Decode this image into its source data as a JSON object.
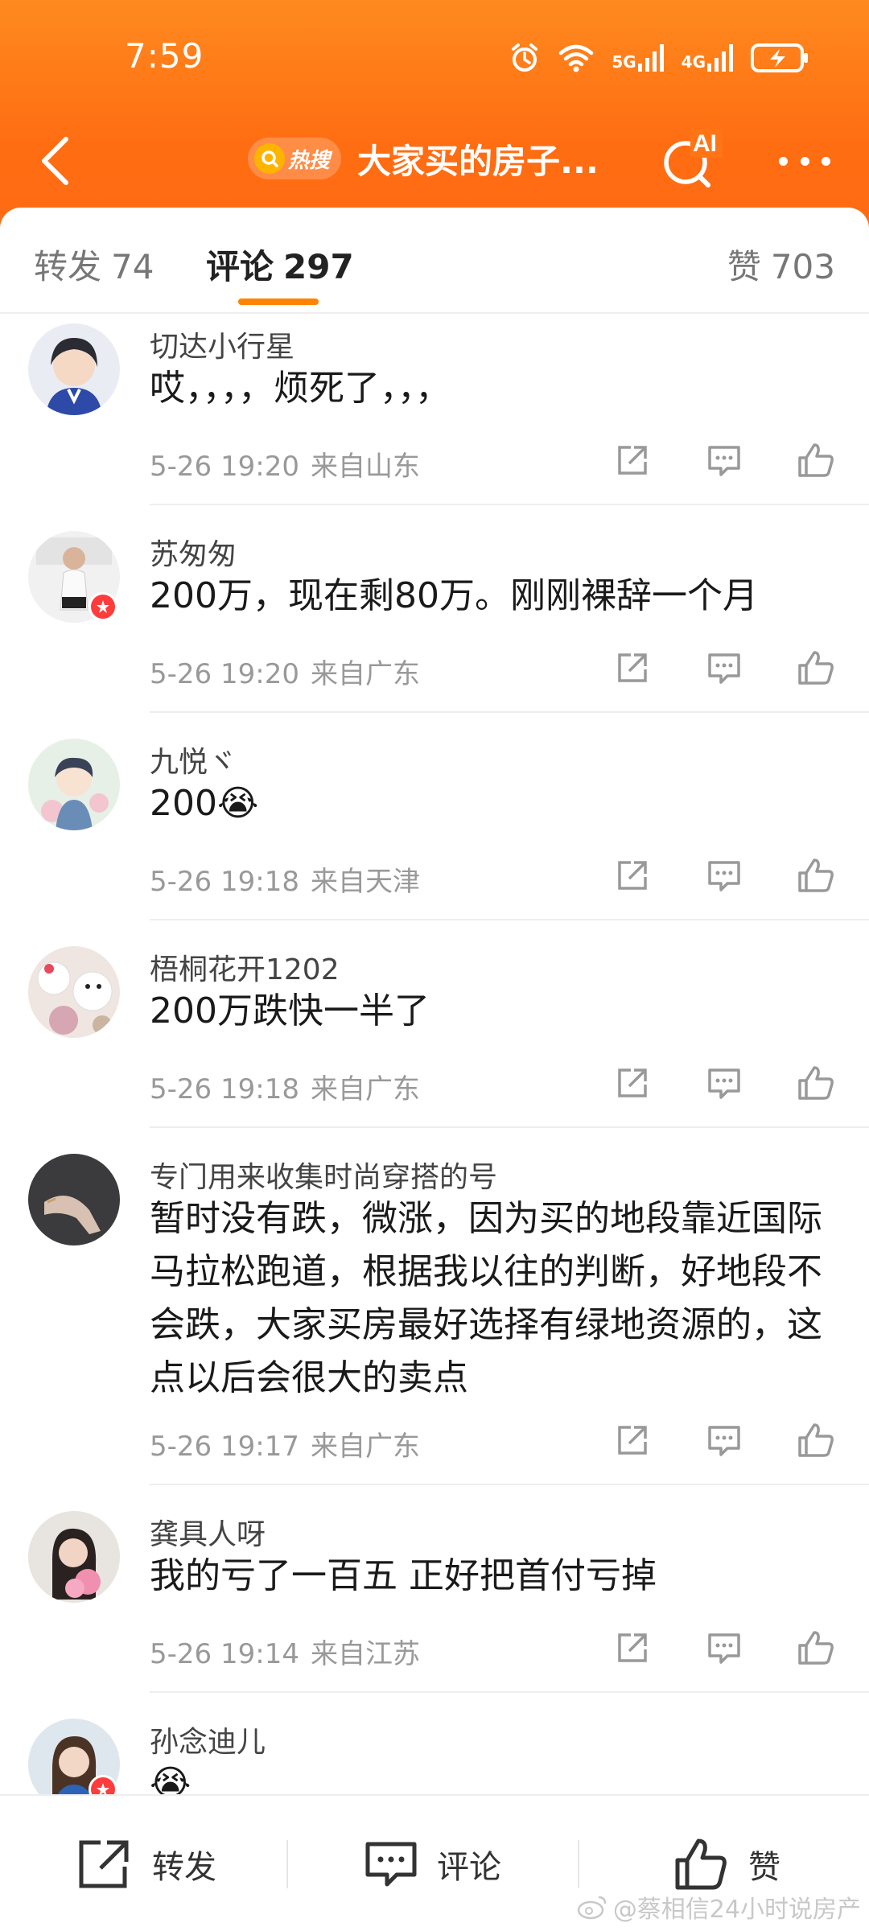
{
  "status_bar": {
    "time": "7:59",
    "network_1": "5G",
    "network_2": "4G"
  },
  "nav": {
    "hot_label": "热搜",
    "title": "大家买的房子...",
    "ai_label": "AI"
  },
  "tabs": [
    {
      "label": "转发",
      "count": "74"
    },
    {
      "label": "评论",
      "count": "297"
    },
    {
      "label": "赞",
      "count": "703"
    }
  ],
  "comments": [
    {
      "name": "切达小行星",
      "text": "哎，，，，烦死了，，，",
      "date": "5-26 19:20",
      "location": "来自山东"
    },
    {
      "name": "苏匆匆",
      "text": "200万，现在剩80万。刚刚裸辞一个月",
      "date": "5-26 19:20",
      "location": "来自广东"
    },
    {
      "name": "九悦ヾ",
      "text": "200😭",
      "date": "5-26 19:18",
      "location": "来自天津"
    },
    {
      "name": "梧桐花开1202",
      "text": "200万跌快一半了",
      "date": "5-26 19:18",
      "location": "来自广东"
    },
    {
      "name": "专门用来收集时尚穿搭的号",
      "text": "暂时没有跌，微涨，因为买的地段靠近国际马拉松跑道，根据我以往的判断，好地段不会跌，大家买房最好选择有绿地资源的，这点以后会很大的卖点",
      "date": "5-26 19:17",
      "location": "来自广东"
    },
    {
      "name": "龚具人呀",
      "text": "我的亏了一百五 正好把首付亏掉",
      "date": "5-26 19:14",
      "location": "来自江苏"
    },
    {
      "name": "孙念迪儿",
      "text": "😭",
      "date": "",
      "location": ""
    }
  ],
  "bottom_bar": {
    "repost": "转发",
    "comment": "评论",
    "like": "赞"
  },
  "watermark": "@蔡相信24小时说房产",
  "colors": {
    "brand_orange": "#ff7a18",
    "tab_indicator": "#ff8200",
    "verified_badge": "#ff3c3c"
  }
}
